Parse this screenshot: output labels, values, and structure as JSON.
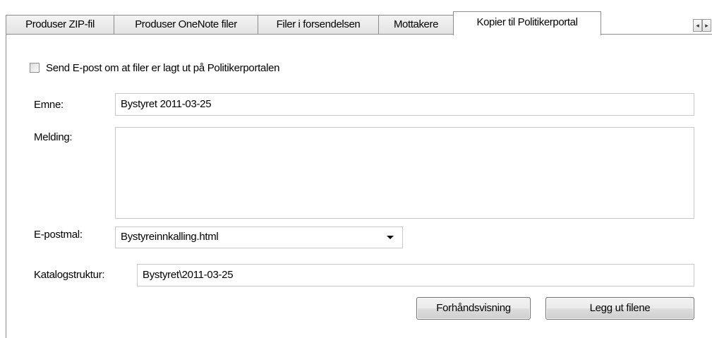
{
  "tabs": [
    {
      "label": "Produser ZIP-fil",
      "active": false
    },
    {
      "label": "Produser OneNote filer",
      "active": false
    },
    {
      "label": "Filer i forsendelsen",
      "active": false
    },
    {
      "label": "Mottakere",
      "active": false
    },
    {
      "label": "Kopier til Politikerportal",
      "active": true
    }
  ],
  "tab_scroll": {
    "left_icon": "triangle-left-icon",
    "right_icon": "triangle-right-icon",
    "left_glyph": "◂",
    "right_glyph": "▸"
  },
  "form": {
    "send_email_checkbox": {
      "label": "Send E-post om at filer er lagt ut på Politikerportalen",
      "checked": false
    },
    "subject": {
      "label": "Emne:",
      "value": "Bystyret 2011-03-25"
    },
    "message": {
      "label": "Melding:",
      "value": ""
    },
    "email_template": {
      "label": "E-postmal:",
      "value": "Bystyreinnkalling.html",
      "icon": "chevron-down-icon"
    },
    "folder_structure": {
      "label": "Katalogstruktur:",
      "value": "Bystyret\\2011-03-25"
    }
  },
  "buttons": {
    "preview": "Forhåndsvisning",
    "publish": "Legg ut filene"
  },
  "colors": {
    "border": "#8c8c8c",
    "textbox_border": "#c8c8c8",
    "background": "#ffffff"
  }
}
